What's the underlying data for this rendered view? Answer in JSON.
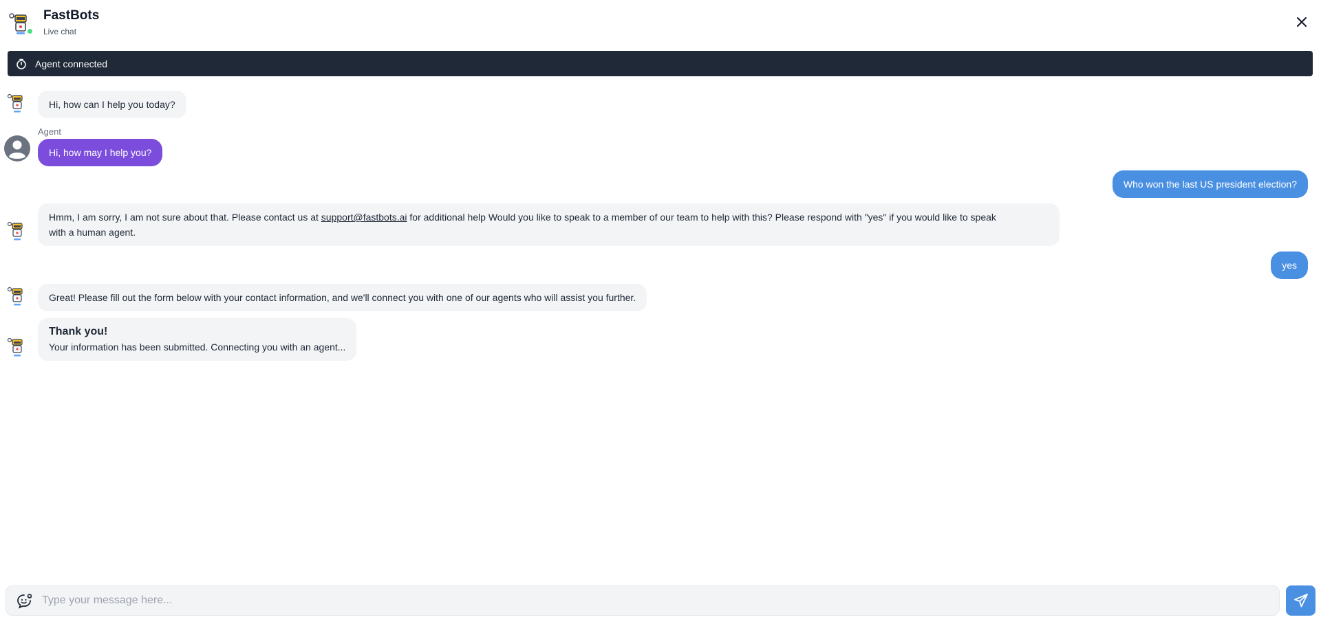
{
  "header": {
    "title": "FastBots",
    "subtitle": "Live chat",
    "status_color": "#4ade80"
  },
  "banner": {
    "icon": "stopwatch-icon",
    "text": "Agent connected"
  },
  "messages": [
    {
      "sender": "bot",
      "text": "Hi, how can I help you today?"
    },
    {
      "sender": "agent",
      "label": "Agent",
      "text": "Hi, how may I help you?"
    },
    {
      "sender": "user",
      "text": "Who won the last US president election?"
    },
    {
      "sender": "bot",
      "text_before": "Hmm, I am sorry, I am not sure about that. Please contact us at ",
      "link": "support@fastbots.ai",
      "text_line1_after": " for additional help Would you like to speak to a member of our team to help with this? Please respond with \"yes\" if you would like to speak",
      "text_line2": "with a human agent."
    },
    {
      "sender": "user",
      "text": "yes"
    },
    {
      "sender": "bot",
      "text": "Great! Please fill out the form below with your contact information, and we'll connect you with one of our agents who will assist you further."
    },
    {
      "sender": "bot",
      "title": "Thank you!",
      "text": "Your information has been submitted. Connecting you with an agent..."
    }
  ],
  "composer": {
    "placeholder": "Type your message here...",
    "emoji_icon": "emoji-chat-icon",
    "send_icon": "send-icon"
  },
  "colors": {
    "banner_bg": "#1f2937",
    "agent_bubble": "#7c4ddd",
    "user_bubble": "#4a90e2",
    "bot_bubble": "#f3f4f6"
  }
}
